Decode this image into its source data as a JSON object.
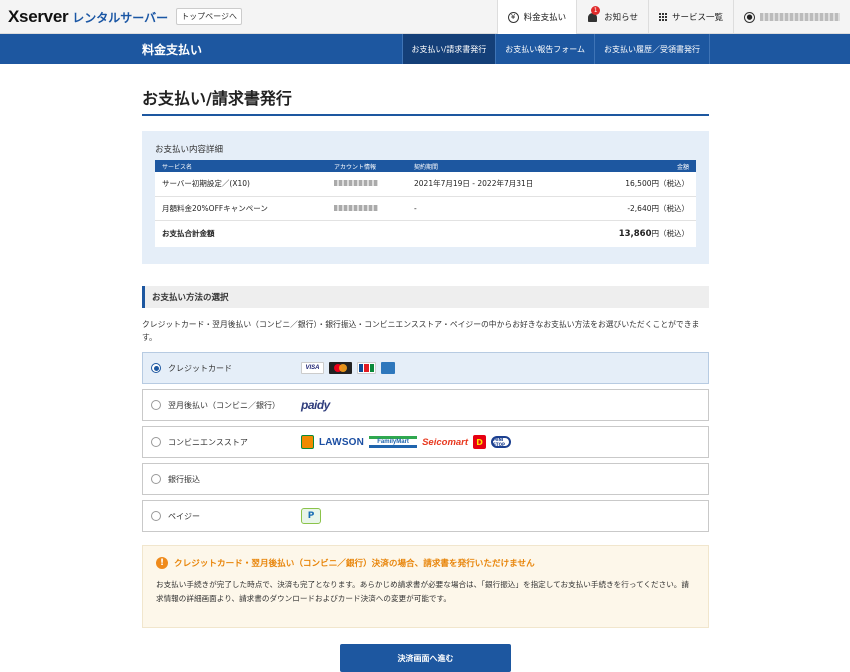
{
  "header": {
    "logo_brand": "Xserver",
    "logo_sub": "レンタルサーバー",
    "top_link": "トップページへ",
    "payment": "料金支払い",
    "notice_count": "1",
    "notices": "お知らせ",
    "services": "サービス一覧"
  },
  "nav": {
    "title": "料金支払い",
    "tabs": [
      {
        "label": "お支払い/請求書発行"
      },
      {
        "label": "お支払い報告フォーム"
      },
      {
        "label": "お支払い履歴／受領書発行"
      }
    ]
  },
  "page_title": "お支払い/請求書発行",
  "detail": {
    "label": "お支払い内容詳細",
    "headers": [
      "サービス名",
      "アカウント情報",
      "契約期間",
      "金額"
    ],
    "rows": [
      {
        "service": "サーバー初期設定／(X10)",
        "period": "2021年7月19日 - 2022年7月31日",
        "amount": "16,500円（税込）"
      },
      {
        "service": "月額料金20%OFFキャンペーン",
        "period": "-",
        "amount": "-2,640円（税込）"
      }
    ],
    "total_label": "お支払合計金額",
    "total_amount": "13,860",
    "total_suffix": "円（税込）"
  },
  "method": {
    "title": "お支払い方法の選択",
    "description": "クレジットカード・翌月後払い（コンビニ／銀行）・銀行振込・コンビニエンスストア・ペイジーの中からお好きなお支払い方法をお選びいただくことができます。",
    "options": [
      {
        "label": "クレジットカード",
        "selected": true
      },
      {
        "label": "翌月後払い（コンビニ／銀行）",
        "selected": false
      },
      {
        "label": "コンビニエンスストア",
        "selected": false
      },
      {
        "label": "銀行振込",
        "selected": false
      },
      {
        "label": "ペイジー",
        "selected": false
      }
    ],
    "logos": {
      "visa": "VISA",
      "paidy": "paidy",
      "lawson": "LAWSON",
      "familymart": "FamilyMart",
      "seicomart": "Seicomart",
      "daily": "D",
      "ministop": "MINI STOP",
      "payeasy": "P"
    }
  },
  "notice": {
    "title": "クレジットカード・翌月後払い（コンビニ／銀行）決済の場合、請求書を発行いただけません",
    "body": "お支払い手続きが完了した時点で、決済も完了となります。あらかじめ請求書が必要な場合は、「銀行振込」を指定してお支払い手続きを行ってください。請求情報の詳細画面より、請求書のダウンロードおよびカード決済への変更が可能です。"
  },
  "submit_label": "決済画面へ進む",
  "colors": {
    "primary": "#1d57a0",
    "warning": "#e8850a"
  }
}
